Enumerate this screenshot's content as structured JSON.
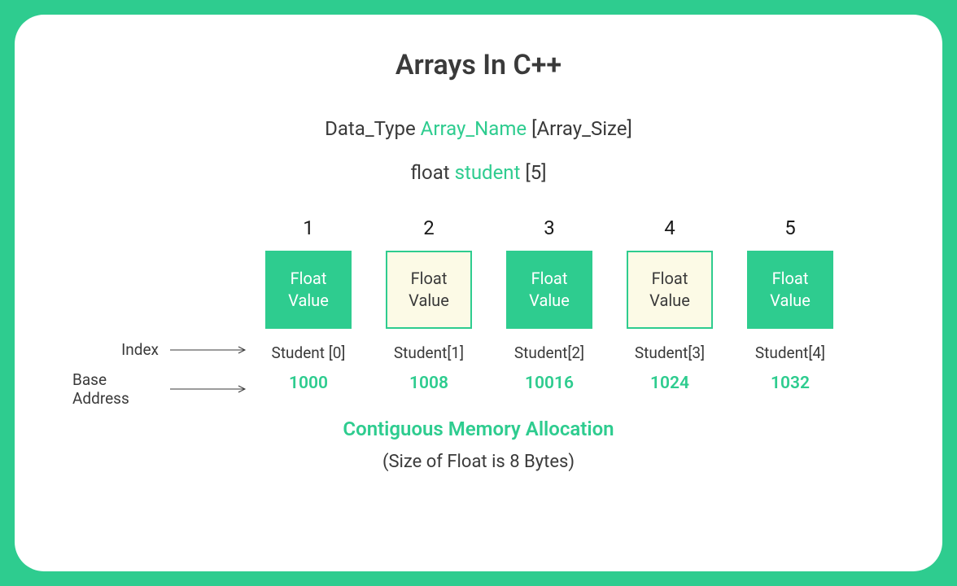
{
  "title": "Arrays In C++",
  "syntax": {
    "pre": "Data_Type ",
    "name": "Array_Name",
    "post": " [Array_Size]"
  },
  "example": {
    "pre": "float ",
    "name": "student",
    "post": " [5]"
  },
  "boxLabel": "Float Value",
  "sideLabels": {
    "index": "Index",
    "baseAddress": "Base Address"
  },
  "columns": [
    {
      "num": "1",
      "filled": true,
      "index": "Student [0]",
      "addr": "1000"
    },
    {
      "num": "2",
      "filled": false,
      "index": "Student[1]",
      "addr": "1008"
    },
    {
      "num": "3",
      "filled": true,
      "index": "Student[2]",
      "addr": "10016"
    },
    {
      "num": "4",
      "filled": false,
      "index": "Student[3]",
      "addr": "1024"
    },
    {
      "num": "5",
      "filled": true,
      "index": "Student[4]",
      "addr": "1032"
    }
  ],
  "footer1": "Contiguous Memory Allocation",
  "footer2": "(Size of Float is 8 Bytes)"
}
